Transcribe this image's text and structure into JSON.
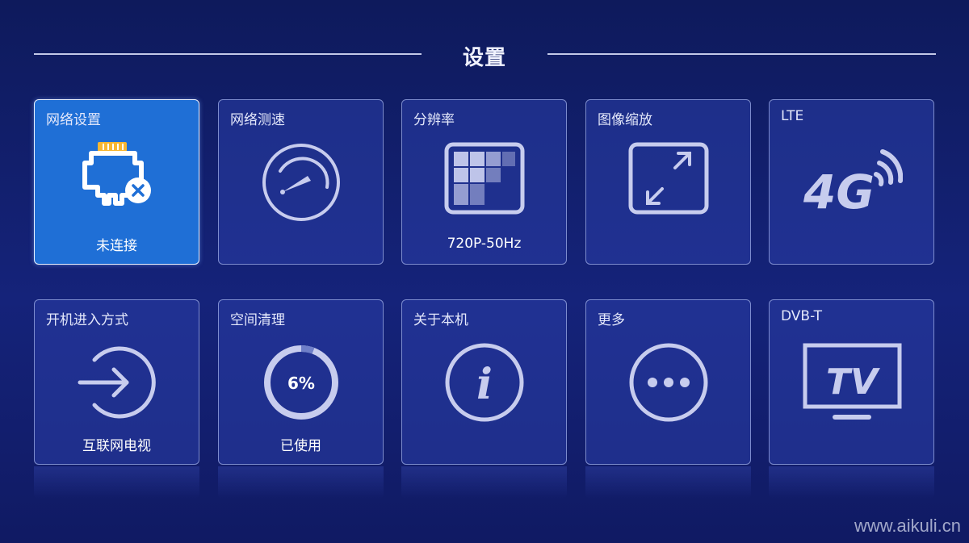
{
  "page": {
    "title": "设置"
  },
  "tiles": [
    {
      "label": "网络设置",
      "sub": "未连接",
      "icon": "ethernet-disconnected-icon"
    },
    {
      "label": "网络测速",
      "icon": "speedometer-icon"
    },
    {
      "label": "分辨率",
      "sub": "720P-50Hz",
      "icon": "resolution-grid-icon"
    },
    {
      "label": "图像缩放",
      "icon": "image-zoom-icon"
    },
    {
      "label": "LTE",
      "icon": "4g-signal-icon",
      "icon_text": "4G"
    },
    {
      "label": "开机进入方式",
      "sub": "互联网电视",
      "icon": "enter-arrow-icon"
    },
    {
      "label": "空间清理",
      "sub": "已使用",
      "icon": "storage-ring-icon",
      "usage_text": "6%",
      "usage_value": 0.06
    },
    {
      "label": "关于本机",
      "icon": "info-icon",
      "icon_text": "i"
    },
    {
      "label": "更多",
      "icon": "more-dots-icon"
    },
    {
      "label": "DVB-T",
      "icon": "tv-icon",
      "icon_text": "TV"
    }
  ],
  "watermark": "www.aikuli.cn",
  "colors": {
    "accent": "#1f6fd6",
    "icon": "#c7ccee"
  }
}
